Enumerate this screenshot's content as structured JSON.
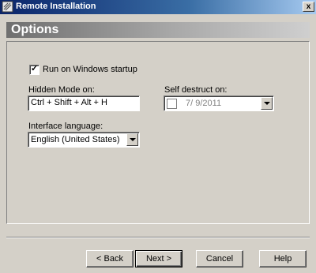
{
  "window": {
    "title": "Remote Installation",
    "close_label": "x"
  },
  "header": {
    "title": "Options"
  },
  "options": {
    "run_on_startup_label": "Run on Windows startup",
    "run_on_startup_checked": true,
    "hidden_mode_label": "Hidden Mode on:",
    "hidden_mode_value": "Ctrl + Shift + Alt + H",
    "self_destruct_label": "Self destruct on:",
    "self_destruct_checked": false,
    "self_destruct_value": "7/  9/2011",
    "interface_language_label": "Interface language:",
    "interface_language_value": "English (United States)"
  },
  "footer": {
    "back": "< Back",
    "next": "Next >",
    "cancel": "Cancel",
    "help": "Help"
  }
}
